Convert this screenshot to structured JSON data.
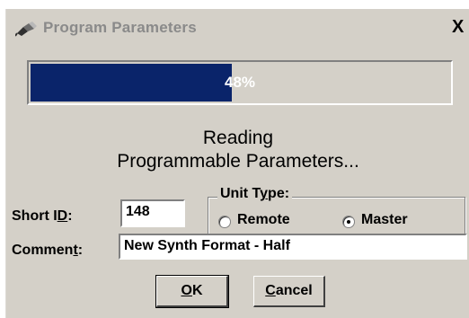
{
  "window": {
    "title": "Program Parameters",
    "close_symbol": "X"
  },
  "progress": {
    "percent": 48,
    "label": "48%",
    "fill_color": "#0a246a"
  },
  "status": {
    "line1": "Reading",
    "line2": "Programmable Parameters..."
  },
  "short_id": {
    "label_prefix": "Short I",
    "label_mnemonic": "D",
    "label_suffix": ":",
    "value": "148"
  },
  "unit_type": {
    "legend_prefix": "Unit T",
    "legend_mnemonic": "y",
    "legend_suffix": "pe:",
    "options": [
      {
        "label": "Remote",
        "selected": false
      },
      {
        "label": "Master",
        "selected": true
      }
    ]
  },
  "comment": {
    "label_prefix": "Commen",
    "label_mnemonic": "t",
    "label_suffix": ":",
    "value": "New Synth Format - Half"
  },
  "buttons": {
    "ok_mnemonic": "O",
    "ok_rest": "K",
    "cancel_mnemonic": "C",
    "cancel_rest": "ancel"
  },
  "icons": {
    "title": "plug-icon",
    "radio": "radio-button-icon"
  }
}
